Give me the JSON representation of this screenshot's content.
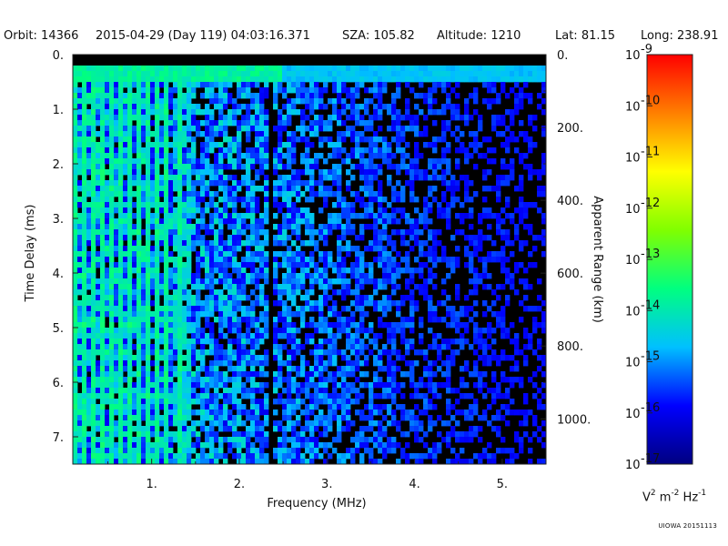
{
  "header": {
    "orbit": "Orbit: 14366",
    "date": "2015-04-29 (Day 119) 04:03:16.371",
    "sza": "SZA: 105.82",
    "altitude": "Altitude:   1210",
    "lat": "Lat:  81.15",
    "long": "Long: 238.91"
  },
  "chart_data": {
    "type": "heatmap",
    "xlabel": "Frequency (MHz)",
    "ylabel": "Time Delay (ms)",
    "y2label": "Apparent Range (km)",
    "xlim": [
      0.1,
      5.5
    ],
    "ylim": [
      7.5,
      0
    ],
    "x_ticks": [
      "1.",
      "2.",
      "3.",
      "4.",
      "5."
    ],
    "x_tick_values": [
      1,
      2,
      3,
      4,
      5
    ],
    "y_ticks": [
      "0.",
      "1.",
      "2.",
      "3.",
      "4.",
      "5.",
      "6.",
      "7."
    ],
    "y_tick_values": [
      0,
      1,
      2,
      3,
      4,
      5,
      6,
      7
    ],
    "y2_ticks": [
      "0.",
      "200.",
      "400.",
      "600.",
      "800.",
      "1000."
    ],
    "y2_tick_values": [
      0,
      200,
      400,
      600,
      800,
      1000
    ],
    "colorbar": {
      "scale": "log",
      "range": [
        1e-17,
        1e-09
      ],
      "tick_mantissa": "10",
      "tick_exponents": [
        "-9",
        "-10",
        "-11",
        "-12",
        "-13",
        "-14",
        "-15",
        "-16",
        "-17"
      ],
      "units": "V m Hz",
      "units_exponents": [
        "2",
        "-2",
        "-1"
      ],
      "colors": [
        "#000080",
        "#0000ff",
        "#00c0ff",
        "#00ff80",
        "#80ff00",
        "#ffff00",
        "#ff8000",
        "#ff0000"
      ]
    },
    "features": {
      "surface_reflection_delay_ms": 0.35,
      "vertical_line_frequency_mhz": 2.35,
      "plasma_harmonics_mhz": [
        0.15,
        0.25,
        0.35,
        0.45,
        0.55,
        0.65,
        0.75,
        0.85,
        0.95,
        1.05,
        1.15,
        1.3
      ]
    }
  },
  "credit": "UIOWA 20151113"
}
